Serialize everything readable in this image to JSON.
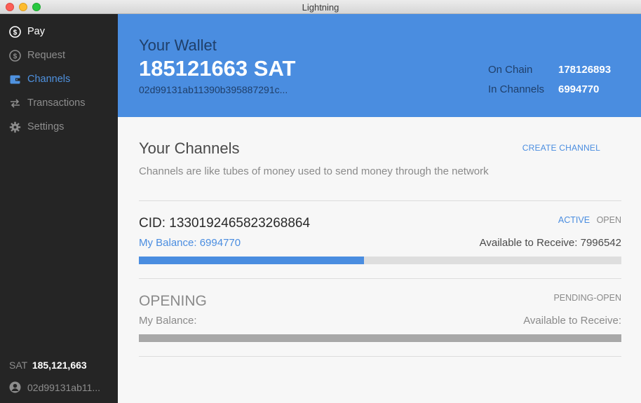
{
  "window": {
    "title": "Lightning"
  },
  "sidebar": {
    "items": [
      {
        "label": "Pay",
        "icon": "dollar-circle-icon"
      },
      {
        "label": "Request",
        "icon": "dollar-circle-icon"
      },
      {
        "label": "Channels",
        "icon": "wallet-icon"
      },
      {
        "label": "Transactions",
        "icon": "swap-arrows-icon"
      },
      {
        "label": "Settings",
        "icon": "gear-icon"
      }
    ],
    "active_item": "Channels",
    "balance_unit": "SAT",
    "balance_value": "185,121,663",
    "identity": "02d99131ab11..."
  },
  "header": {
    "label": "Your Wallet",
    "amount": "185121663 SAT",
    "pubkey": "02d99131ab11390b395887291c...",
    "on_chain_label": "On Chain",
    "on_chain_value": "178126893",
    "in_channels_label": "In Channels",
    "in_channels_value": "6994770"
  },
  "main": {
    "title": "Your Channels",
    "create_label": "CREATE CHANNEL",
    "description": "Channels are like tubes of money used to send money through the network"
  },
  "channels": [
    {
      "title": "CID: 1330192465823268864",
      "status_active": "ACTIVE",
      "status_open": "OPEN",
      "my_balance": "My Balance: 6994770",
      "available": "Available to Receive: 7996542",
      "local_fraction": 0.466
    },
    {
      "title": "OPENING",
      "status": "PENDING-OPEN",
      "my_balance": "My Balance:",
      "available": "Available to Receive:"
    }
  ],
  "colors": {
    "accent": "#4a8de0",
    "sidebar_bg": "#252525",
    "header_bg": "#4a8de0"
  }
}
